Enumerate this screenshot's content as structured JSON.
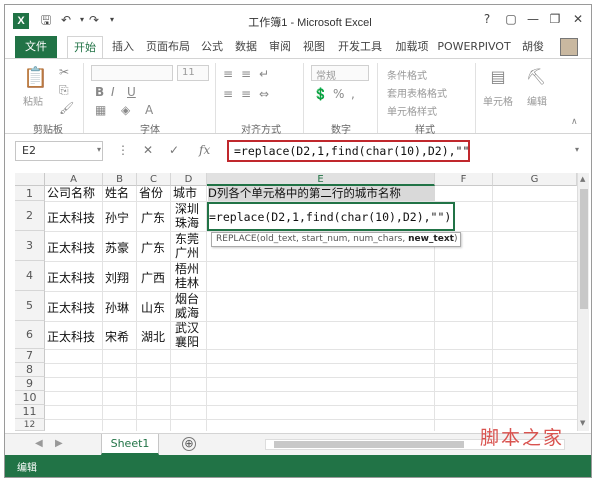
{
  "window": {
    "title": "工作簿1 - Microsoft Excel",
    "app_icon": "X",
    "controls": [
      "?",
      "▢",
      "—",
      "❐",
      "✕"
    ]
  },
  "tabs": {
    "file": "文件",
    "items": [
      "开始",
      "插入",
      "页面布局",
      "公式",
      "数据",
      "审阅",
      "视图",
      "开发工具",
      "加载项",
      "POWERPIVOT"
    ],
    "active": "开始",
    "user": "胡俊"
  },
  "ribbon": {
    "clipboard": {
      "paste": "粘贴",
      "label": "剪贴板"
    },
    "font": {
      "size": "11",
      "label": "字体",
      "bold": "B",
      "italic": "I",
      "underline": "U"
    },
    "alignment": {
      "label": "对齐方式"
    },
    "number": {
      "format": "常规",
      "label": "数字",
      "percent": "%"
    },
    "styles": {
      "conditional": "条件格式",
      "table": "套用表格格式",
      "cell": "单元格样式",
      "label": "样式"
    },
    "cells": {
      "label": "单元格"
    },
    "editing": {
      "label": "编辑"
    }
  },
  "formula_bar": {
    "name_box": "E2",
    "cancel": "✕",
    "confirm": "✓",
    "fx": "fx",
    "formula": "=replace(D2,1,find(char(10),D2),\"\")"
  },
  "grid": {
    "columns": [
      "A",
      "B",
      "C",
      "D",
      "E",
      "F",
      "G"
    ],
    "row_numbers": [
      "1",
      "2",
      "3",
      "4",
      "5",
      "6",
      "7",
      "8",
      "9",
      "10",
      "11",
      "12"
    ],
    "header_row": [
      "公司名称",
      "姓名",
      "省份",
      "城市",
      "D列各个单元格中的第二行的城市名称"
    ],
    "rows": [
      {
        "company": "正太科技",
        "name": "孙宁",
        "province": "广东",
        "city_line1": "深圳",
        "city_line2": "珠海"
      },
      {
        "company": "正太科技",
        "name": "苏豪",
        "province": "广东",
        "city_line1": "东莞",
        "city_line2": "广州"
      },
      {
        "company": "正太科技",
        "name": "刘翔",
        "province": "广西",
        "city_line1": "梧州",
        "city_line2": "桂林"
      },
      {
        "company": "正太科技",
        "name": "孙琳",
        "province": "山东",
        "city_line1": "烟台",
        "city_line2": "威海"
      },
      {
        "company": "正太科技",
        "name": "宋希",
        "province": "湖北",
        "city_line1": "武汉",
        "city_line2": "襄阳"
      }
    ],
    "editing_cell_text": "=replace(D2,1,find(char(10),D2),\"\")",
    "tooltip": {
      "prefix": "REPLACE(old_text, start_num, num_chars, ",
      "current": "new_text",
      "suffix": ")"
    }
  },
  "sheets": {
    "tabs": [
      "Sheet1"
    ],
    "add": "⊕"
  },
  "status": {
    "mode": "编辑"
  },
  "watermark": "脚本之家",
  "colors": {
    "excel_green": "#217346",
    "highlight_red": "#c0282d"
  }
}
